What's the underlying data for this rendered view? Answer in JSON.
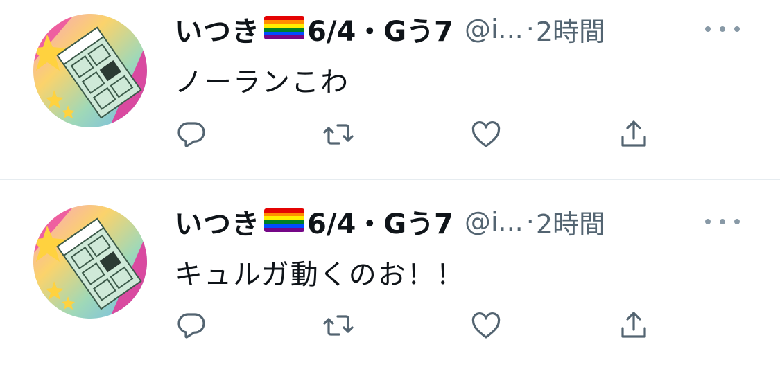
{
  "colors": {
    "text_primary": "#0f1419",
    "text_secondary": "#536471",
    "icon": "#536471",
    "divider": "#e6ecf0",
    "background": "#ffffff"
  },
  "flag_stripes": [
    "#e40303",
    "#ff8c00",
    "#ffed00",
    "#008026",
    "#004dff",
    "#750787"
  ],
  "tweets": [
    {
      "display_name": "いつき",
      "flag_icon": "rainbow-flag-emoji",
      "name_suffix": "6/4・Gう7",
      "handle": "@i...",
      "separator": "·",
      "time": "2時間",
      "text": "ノーランこわ",
      "actions": {
        "reply_icon": "reply-icon",
        "retweet_icon": "retweet-icon",
        "like_icon": "heart-icon",
        "share_icon": "share-icon"
      }
    },
    {
      "display_name": "いつき",
      "flag_icon": "rainbow-flag-emoji",
      "name_suffix": "6/4・Gう7",
      "handle": "@i...",
      "separator": "·",
      "time": "2時間",
      "text": "キュルガ動くのお！！",
      "actions": {
        "reply_icon": "reply-icon",
        "retweet_icon": "retweet-icon",
        "like_icon": "heart-icon",
        "share_icon": "share-icon"
      }
    }
  ]
}
